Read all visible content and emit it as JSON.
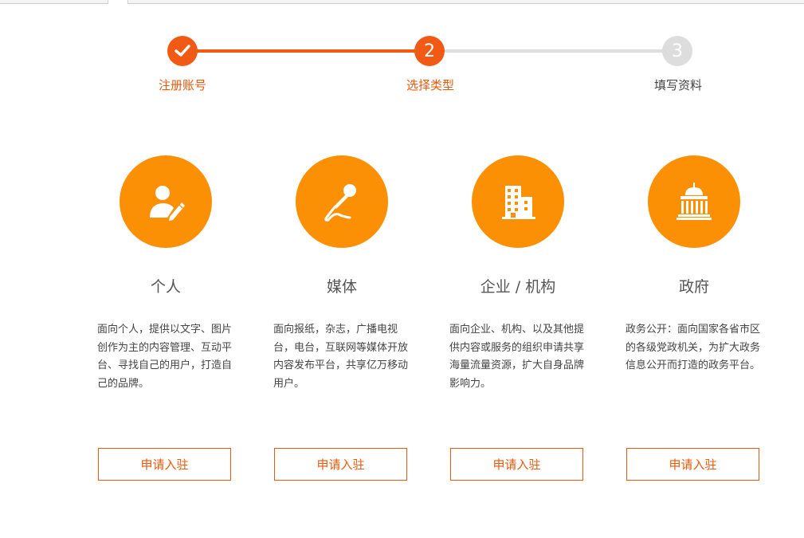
{
  "steps": [
    {
      "number": "",
      "label": "注册账号",
      "status": "done",
      "icon": "check-icon"
    },
    {
      "number": "2",
      "label": "选择类型",
      "status": "current"
    },
    {
      "number": "3",
      "label": "填写资料",
      "status": "todo"
    }
  ],
  "colors": {
    "accent": "#f05a14",
    "card_circle": "#fb9005",
    "inactive": "#dddddd"
  },
  "cards": [
    {
      "icon": "person-edit-icon",
      "title": "个人",
      "desc": "面向个人，提供以文字、图片创作为主的内容管理、互动平台、寻找自己的用户，打造自己的品牌。",
      "button": "申请入驻"
    },
    {
      "icon": "microphone-icon",
      "title": "媒体",
      "desc": "面向报纸，杂志，广播电视台，电台，互联网等媒体开放内容发布平台，共享亿万移动用户。",
      "button": "申请入驻"
    },
    {
      "icon": "building-icon",
      "title": "企业 / 机构",
      "desc": "面向企业、机构、以及其他提供内容或服务的组织申请共享海量流量资源，扩大自身品牌影响力。",
      "button": "申请入驻"
    },
    {
      "icon": "government-building-icon",
      "title": "政府",
      "desc": "政务公开：面向国家各省市区的各级党政机关，为扩大政务信息公开而打造的政务平台。",
      "button": "申请入驻"
    }
  ]
}
